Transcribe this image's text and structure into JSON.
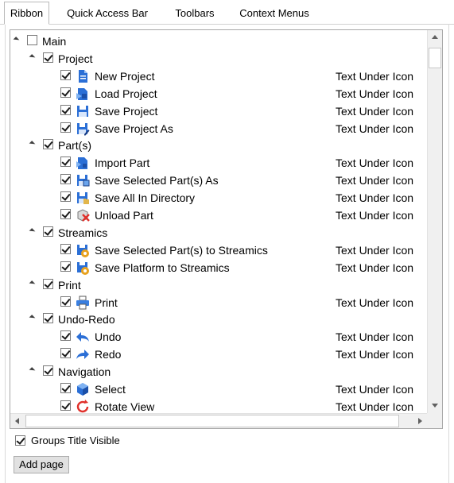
{
  "tabs": [
    "Ribbon",
    "Quick Access Bar",
    "Toolbars",
    "Context Menus"
  ],
  "tree": [
    {
      "level": 0,
      "label": "Main",
      "checked": false,
      "expander": true,
      "icon": null,
      "caption": ""
    },
    {
      "level": 1,
      "label": "Project",
      "checked": true,
      "expander": true,
      "icon": null,
      "caption": ""
    },
    {
      "level": 2,
      "label": "New Project",
      "checked": true,
      "expander": false,
      "icon": "new-project-icon",
      "caption": "Text Under Icon"
    },
    {
      "level": 2,
      "label": "Load Project",
      "checked": true,
      "expander": false,
      "icon": "load-project-icon",
      "caption": "Text Under Icon"
    },
    {
      "level": 2,
      "label": "Save Project",
      "checked": true,
      "expander": false,
      "icon": "save-project-icon",
      "caption": "Text Under Icon"
    },
    {
      "level": 2,
      "label": "Save Project As",
      "checked": true,
      "expander": false,
      "icon": "save-project-as-icon",
      "caption": "Text Under Icon"
    },
    {
      "level": 1,
      "label": "Part(s)",
      "checked": true,
      "expander": true,
      "icon": null,
      "caption": ""
    },
    {
      "level": 2,
      "label": "Import Part",
      "checked": true,
      "expander": false,
      "icon": "import-part-icon",
      "caption": "Text Under Icon"
    },
    {
      "level": 2,
      "label": "Save Selected Part(s) As",
      "checked": true,
      "expander": false,
      "icon": "save-selected-parts-icon",
      "caption": "Text Under Icon"
    },
    {
      "level": 2,
      "label": "Save All In Directory",
      "checked": true,
      "expander": false,
      "icon": "save-all-directory-icon",
      "caption": "Text Under Icon"
    },
    {
      "level": 2,
      "label": "Unload Part",
      "checked": true,
      "expander": false,
      "icon": "unload-part-icon",
      "caption": "Text Under Icon"
    },
    {
      "level": 1,
      "label": "Streamics",
      "checked": true,
      "expander": true,
      "icon": null,
      "caption": ""
    },
    {
      "level": 2,
      "label": "Save Selected Part(s) to Streamics",
      "checked": true,
      "expander": false,
      "icon": "streamics-part-icon",
      "caption": "Text Under Icon"
    },
    {
      "level": 2,
      "label": "Save Platform to Streamics",
      "checked": true,
      "expander": false,
      "icon": "streamics-platform-icon",
      "caption": "Text Under Icon"
    },
    {
      "level": 1,
      "label": "Print",
      "checked": true,
      "expander": true,
      "icon": null,
      "caption": ""
    },
    {
      "level": 2,
      "label": "Print",
      "checked": true,
      "expander": false,
      "icon": "print-icon",
      "caption": "Text Under Icon"
    },
    {
      "level": 1,
      "label": "Undo-Redo",
      "checked": true,
      "expander": true,
      "icon": null,
      "caption": ""
    },
    {
      "level": 2,
      "label": "Undo",
      "checked": true,
      "expander": false,
      "icon": "undo-icon",
      "caption": "Text Under Icon"
    },
    {
      "level": 2,
      "label": "Redo",
      "checked": true,
      "expander": false,
      "icon": "redo-icon",
      "caption": "Text Under Icon"
    },
    {
      "level": 1,
      "label": "Navigation",
      "checked": true,
      "expander": true,
      "icon": null,
      "caption": ""
    },
    {
      "level": 2,
      "label": "Select",
      "checked": true,
      "expander": false,
      "icon": "select-cube-icon",
      "caption": "Text Under Icon"
    },
    {
      "level": 2,
      "label": "Rotate View",
      "checked": true,
      "expander": false,
      "icon": "rotate-view-icon",
      "caption": "Text Under Icon"
    }
  ],
  "footer": {
    "groups_title_label": "Groups Title Visible",
    "groups_title_checked": true,
    "add_page_label": "Add page"
  }
}
